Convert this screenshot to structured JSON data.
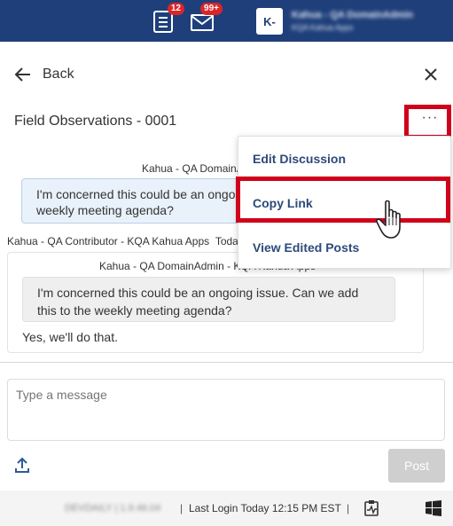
{
  "header": {
    "notifications_count": "12",
    "messages_count": "99+",
    "avatar_initials": "K-",
    "user_name": "Kahua - QA DomainAdmin",
    "user_org": "KQA Kahua Apps"
  },
  "nav": {
    "back_label": "Back"
  },
  "discussion": {
    "title": "Field Observations - 0001",
    "more_label": "···"
  },
  "messages": [
    {
      "author": "Kahua - QA DomainA",
      "text": "I'm concerned this could be an ongoing weekly meeting agenda?"
    },
    {
      "author": "Kahua - QA Contributor - KQA Kahua Apps",
      "time": "Today",
      "quoted_author": "Kahua - QA DomainAdmin - KQA Kahua Apps",
      "quoted_text": "I'm concerned this could be an ongoing issue.  Can we add this to the weekly meeting agenda?",
      "text": "Yes, we'll do that."
    }
  ],
  "menu": {
    "items": [
      {
        "label": "Edit Discussion"
      },
      {
        "label": "Copy Link"
      },
      {
        "label": "View Edited Posts"
      }
    ]
  },
  "composer": {
    "placeholder": "Type a message",
    "post_label": "Post"
  },
  "footer": {
    "env_label": "DEVDAILY  |  1.9.46.04",
    "separator": "|",
    "last_login": "Last Login Today 12:15 PM EST"
  },
  "colors": {
    "header_bg": "#1f3f7a",
    "badge": "#d9262a",
    "menu_text": "#2c4a7a",
    "highlight": "#d0021b",
    "bubble_bg": "#e9f1fb"
  },
  "icons": [
    "checklist-icon",
    "mail-icon",
    "arrow-left-icon",
    "close-icon",
    "more-icon",
    "upload-icon",
    "activity-icon",
    "windows-icon",
    "hand-cursor-icon"
  ]
}
